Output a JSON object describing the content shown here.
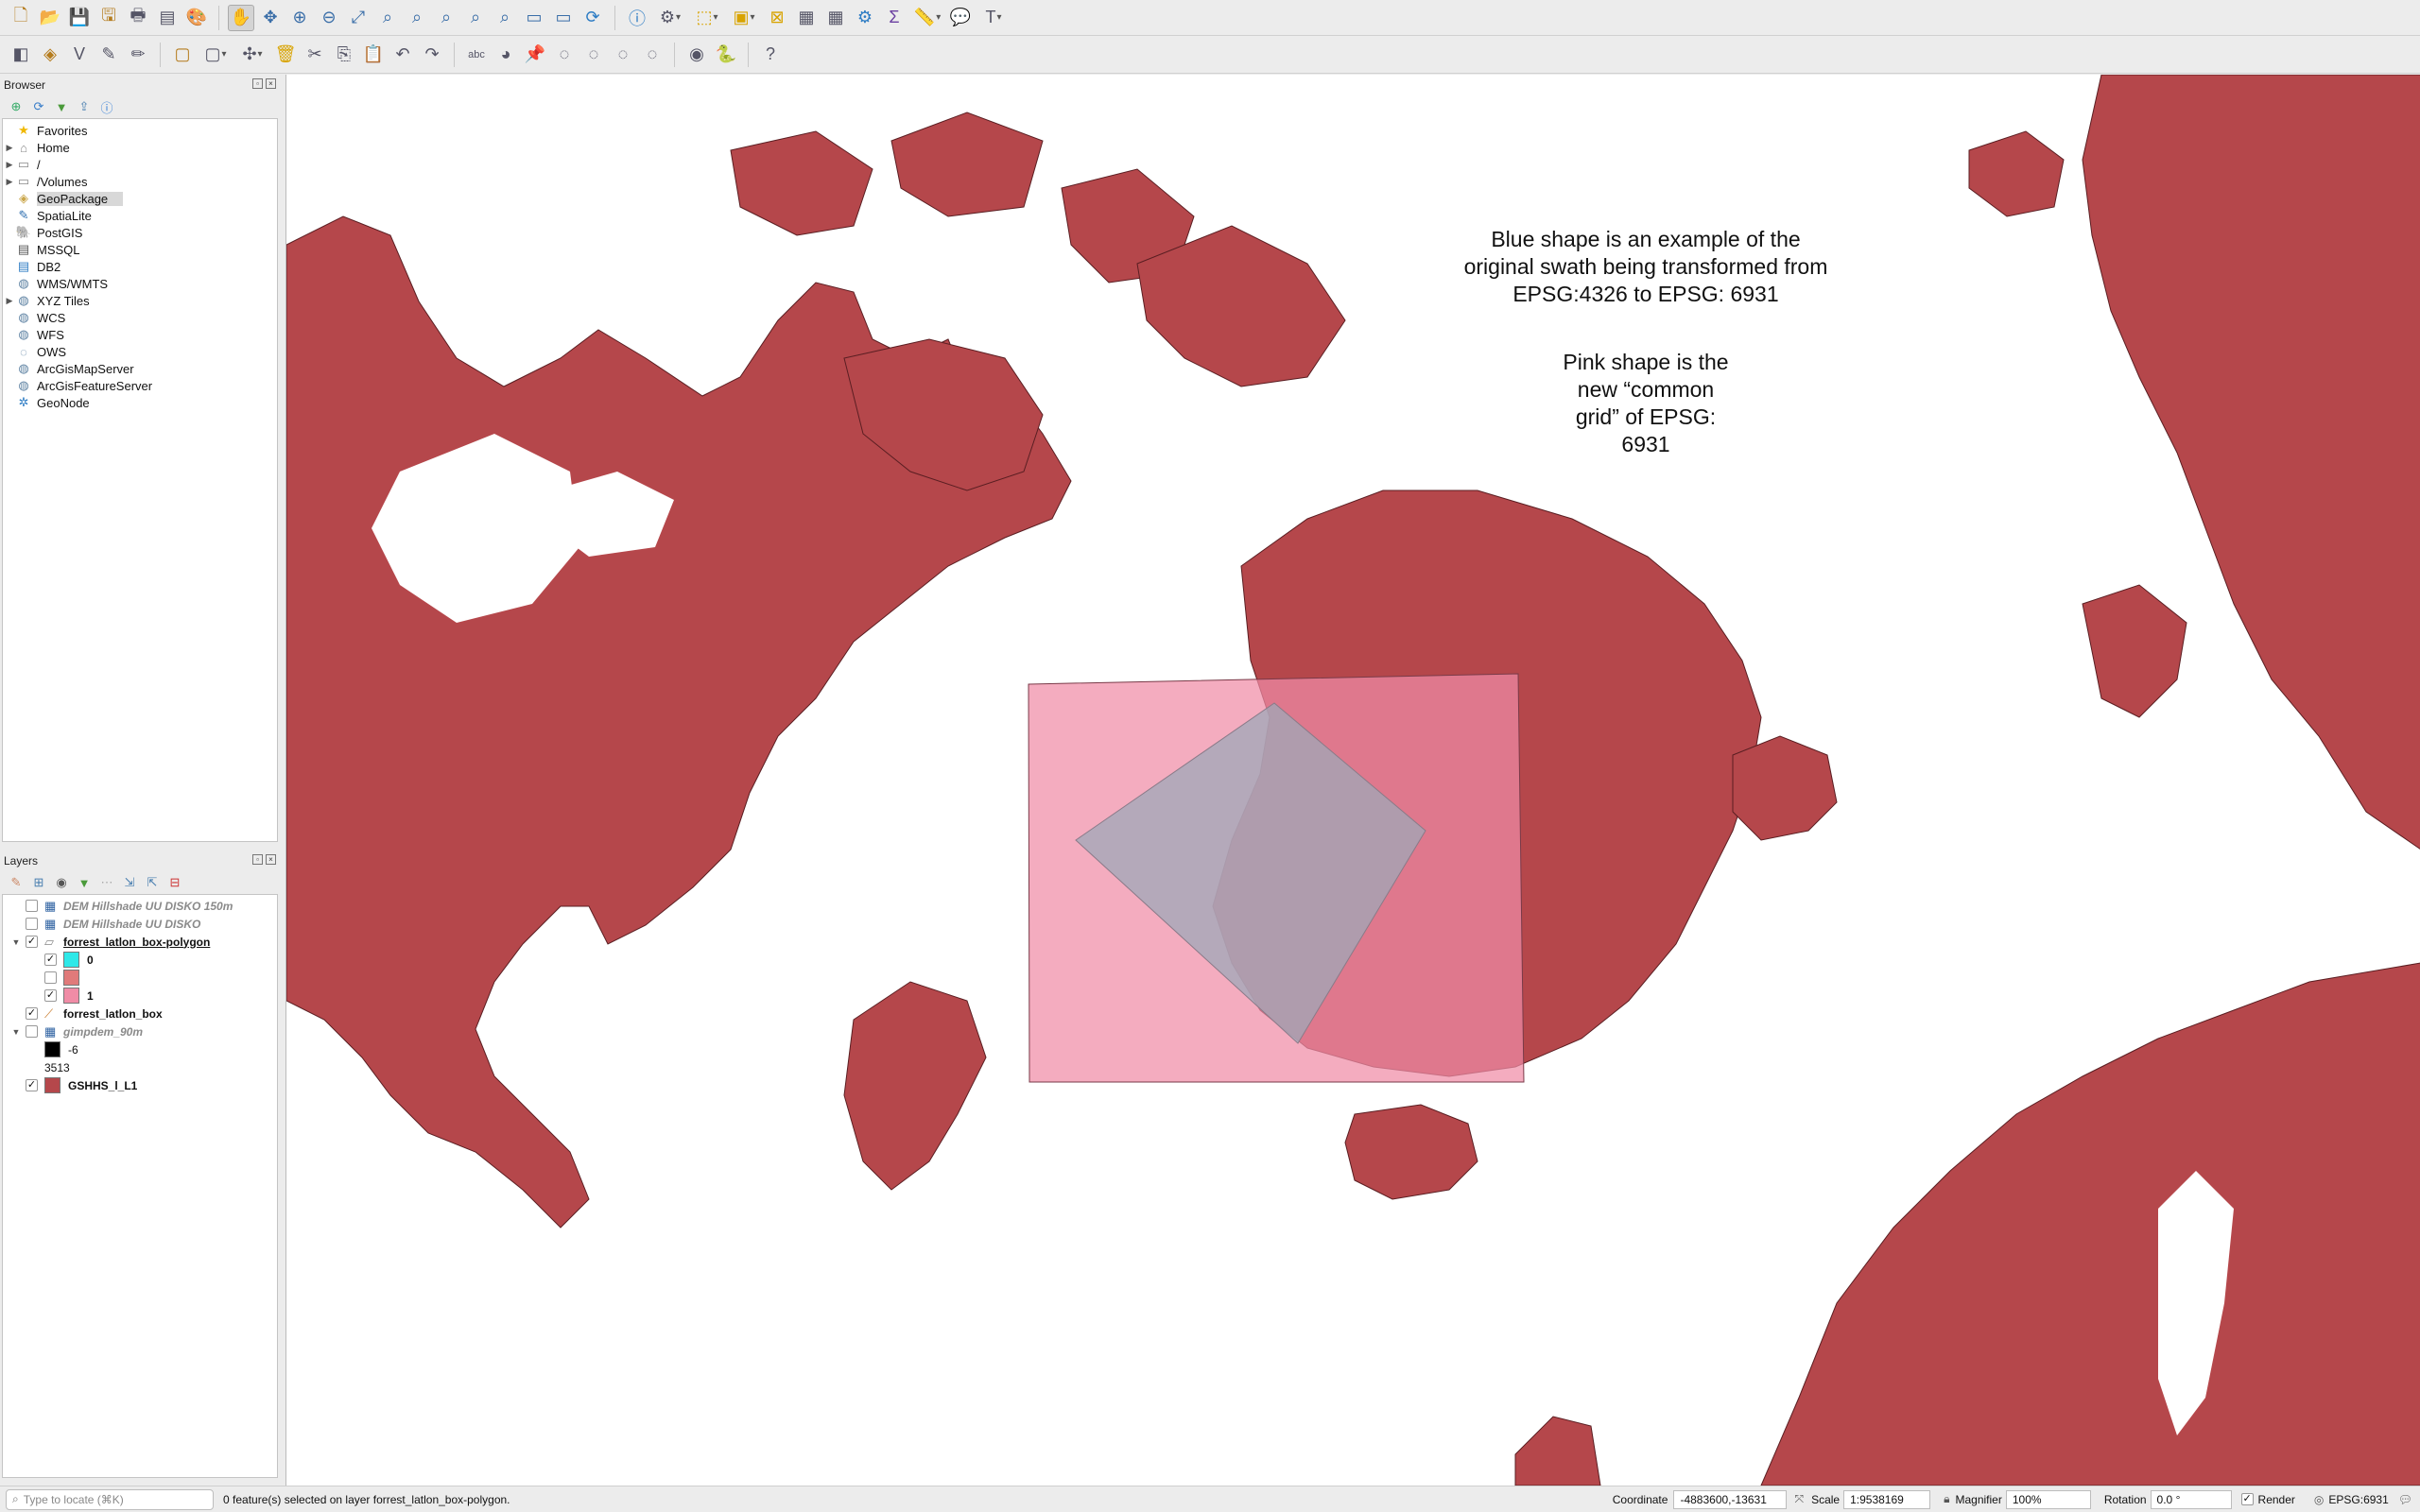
{
  "toolbar_top": {
    "icons": [
      "new-project-icon",
      "open-project-icon",
      "save-project-icon",
      "save-as-icon",
      "print-layout-icon",
      "layout-manager-icon",
      "style-manager-icon",
      "pan-icon",
      "pan-to-selection-icon",
      "zoom-in-icon",
      "zoom-out-icon",
      "zoom-full-icon",
      "zoom-selection-icon",
      "zoom-layer-icon",
      "zoom-native-icon",
      "zoom-last-icon",
      "zoom-next-icon",
      "new-bookmark-icon",
      "show-bookmarks-icon",
      "refresh-icon",
      "identify-icon",
      "run-action-icon",
      "select-features-icon",
      "select-by-value-icon",
      "deselect-icon",
      "attribute-table-icon",
      "field-calculator-icon",
      "toolbox-icon",
      "statistics-icon",
      "measure-icon",
      "map-tips-icon",
      "text-annotation-icon"
    ]
  },
  "toolbar_second": {
    "icons": [
      "data-source-manager-icon",
      "new-geopackage-layer-icon",
      "digitize-icon",
      "current-edits-icon",
      "toggle-editing-icon",
      "save-edits-icon",
      "add-feature-icon",
      "vertex-tool-icon",
      "delete-selected-icon",
      "cut-features-icon",
      "copy-features-icon",
      "paste-features-icon",
      "undo-icon",
      "redo-icon",
      "label-icon",
      "layer-diagram-icon",
      "pin-labels-icon",
      "show-hide-labels-icon",
      "move-label-icon",
      "rotate-label-icon",
      "change-label-icon",
      "plugin-icon",
      "python-console-icon",
      "help-icon"
    ]
  },
  "browser": {
    "title": "Browser",
    "items": [
      {
        "label": "Favorites",
        "icon": "star-icon",
        "arrow": false
      },
      {
        "label": "Home",
        "icon": "home-folder-icon",
        "arrow": true
      },
      {
        "label": "/",
        "icon": "folder-icon",
        "arrow": true
      },
      {
        "label": "/Volumes",
        "icon": "folder-icon",
        "arrow": true
      },
      {
        "label": "GeoPackage",
        "icon": "geopackage-icon",
        "arrow": false,
        "selected": true
      },
      {
        "label": "SpatiaLite",
        "icon": "spatialite-icon",
        "arrow": false
      },
      {
        "label": "PostGIS",
        "icon": "postgis-icon",
        "arrow": false
      },
      {
        "label": "MSSQL",
        "icon": "mssql-icon",
        "arrow": false
      },
      {
        "label": "DB2",
        "icon": "db2-icon",
        "arrow": false
      },
      {
        "label": "WMS/WMTS",
        "icon": "wms-icon",
        "arrow": false
      },
      {
        "label": "XYZ Tiles",
        "icon": "xyz-tiles-icon",
        "arrow": true
      },
      {
        "label": "WCS",
        "icon": "wcs-icon",
        "arrow": false
      },
      {
        "label": "WFS",
        "icon": "wfs-icon",
        "arrow": false
      },
      {
        "label": "OWS",
        "icon": "ows-icon",
        "arrow": false
      },
      {
        "label": "ArcGisMapServer",
        "icon": "arcgis-map-icon",
        "arrow": false
      },
      {
        "label": "ArcGisFeatureServer",
        "icon": "arcgis-feature-icon",
        "arrow": false
      },
      {
        "label": "GeoNode",
        "icon": "geonode-icon",
        "arrow": false
      }
    ]
  },
  "layers": {
    "title": "Layers",
    "rows": [
      {
        "label": "DEM Hillshade UU DISKO 150m",
        "checked": false,
        "style": "italic-grey",
        "indent": 0,
        "arrow": false,
        "icon": "raster-icon"
      },
      {
        "label": "DEM Hillshade UU DISKO",
        "checked": false,
        "style": "italic-grey",
        "indent": 0,
        "arrow": false,
        "icon": "raster-icon"
      },
      {
        "label": "forrest_latlon_box-polygon",
        "checked": true,
        "style": "bold-underline",
        "indent": 0,
        "arrow": true,
        "icon": "polygon-layer-icon"
      },
      {
        "label": "0",
        "checked": true,
        "style": "bold",
        "indent": 1,
        "swatch": "#2ee8e8"
      },
      {
        "label": "",
        "checked": false,
        "style": "plain",
        "indent": 1,
        "swatch": "#e07a7a"
      },
      {
        "label": "1",
        "checked": true,
        "style": "bold",
        "indent": 1,
        "swatch": "#f08ca6"
      },
      {
        "label": "forrest_latlon_box",
        "checked": true,
        "style": "bold",
        "indent": 0,
        "arrow": false,
        "icon": "line-layer-icon"
      },
      {
        "label": "gimpdem_90m",
        "checked": false,
        "style": "italic-grey",
        "indent": 0,
        "arrow": true,
        "icon": "raster-icon"
      },
      {
        "label": "-6",
        "checked": null,
        "style": "plain",
        "indent": 1,
        "swatch": "#000000"
      },
      {
        "label": "3513",
        "checked": null,
        "style": "plain",
        "indent": 1,
        "swatch": null
      },
      {
        "label": "GSHHS_l_L1",
        "checked": true,
        "style": "bold",
        "indent": 0,
        "arrow": false,
        "swatch": "#b5474b"
      }
    ]
  },
  "map": {
    "land_color": "#b5474b",
    "pink_color": "#f08ca6",
    "blue_color": "#9fa8b8",
    "annotation_1": [
      "Blue shape is an example of the",
      "original swath being transformed from",
      "EPSG:4326 to EPSG: 6931"
    ],
    "annotation_2": [
      "Pink shape is the",
      "new “common",
      "grid” of EPSG:",
      "6931"
    ]
  },
  "status": {
    "locate_placeholder": "Type to locate (⌘K)",
    "message": "0 feature(s) selected on layer forrest_latlon_box-polygon.",
    "coordinate_label": "Coordinate",
    "coordinate_value": "-4883600,-13631",
    "scale_label": "Scale",
    "scale_value": "1:9538169",
    "magnifier_label": "Magnifier",
    "magnifier_value": "100%",
    "rotation_label": "Rotation",
    "rotation_value": "0.0 °",
    "render_label": "Render",
    "render_checked": true,
    "crs": "EPSG:6931"
  }
}
